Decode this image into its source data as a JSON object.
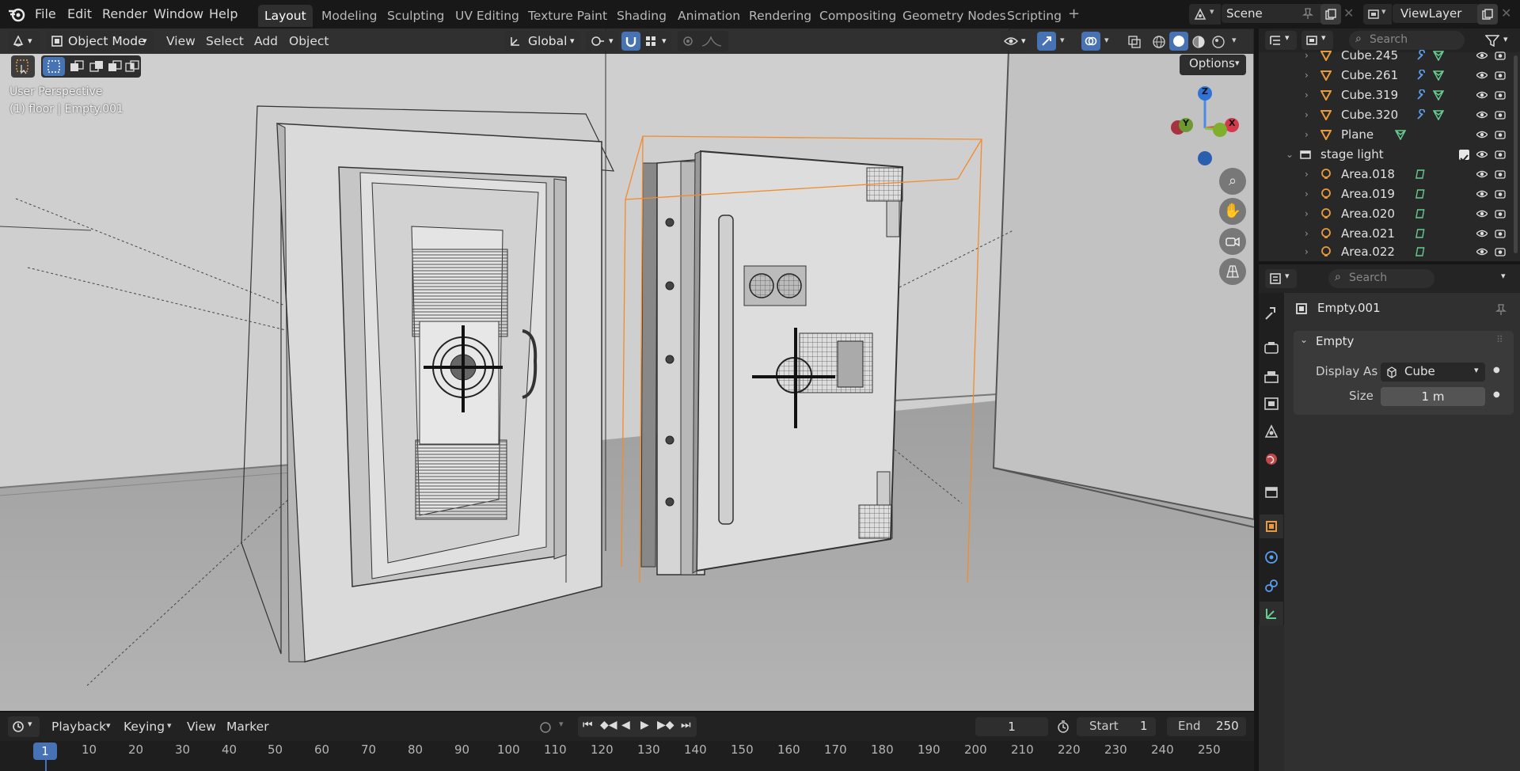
{
  "topbar": {
    "menus": [
      "File",
      "Edit",
      "Render",
      "Window",
      "Help"
    ],
    "workspaces": [
      "Layout",
      "Modeling",
      "Sculpting",
      "UV Editing",
      "Texture Paint",
      "Shading",
      "Animation",
      "Rendering",
      "Compositing",
      "Geometry Nodes",
      "Scripting"
    ],
    "active_workspace": "Layout",
    "add_workspace": "+",
    "scene": "Scene",
    "view_layer": "ViewLayer"
  },
  "viewport": {
    "mode": "Object Mode",
    "menus": [
      "View",
      "Select",
      "Add",
      "Object"
    ],
    "transform_orientation": "Global",
    "options_label": "Options",
    "overlay_text_1": "User Perspective",
    "overlay_text_2": "(1) floor | Empty.001",
    "gizmo": {
      "x": "X",
      "y": "Y",
      "z": "Z"
    }
  },
  "timeline": {
    "menus": [
      "Playback",
      "Keying",
      "View",
      "Marker"
    ],
    "current_frame": "1",
    "start_label": "Start",
    "start_value": "1",
    "end_label": "End",
    "end_value": "250",
    "ruler": [
      "1",
      "10",
      "20",
      "30",
      "40",
      "50",
      "60",
      "70",
      "80",
      "90",
      "100",
      "110",
      "120",
      "130",
      "140",
      "150",
      "160",
      "170",
      "180",
      "190",
      "200",
      "210",
      "220",
      "230",
      "240",
      "250"
    ]
  },
  "outliner": {
    "search_placeholder": "Search",
    "rows": [
      {
        "name": "Cube.245",
        "type": "mesh"
      },
      {
        "name": "Cube.261",
        "type": "mesh"
      },
      {
        "name": "Cube.319",
        "type": "mesh"
      },
      {
        "name": "Cube.320",
        "type": "mesh"
      },
      {
        "name": "Plane",
        "type": "mesh"
      },
      {
        "name": "stage light",
        "type": "collection"
      },
      {
        "name": "Area.018",
        "type": "light"
      },
      {
        "name": "Area.019",
        "type": "light"
      },
      {
        "name": "Area.020",
        "type": "light"
      },
      {
        "name": "Area.021",
        "type": "light"
      },
      {
        "name": "Area.022",
        "type": "light"
      }
    ]
  },
  "properties": {
    "search_placeholder": "Search",
    "object_name": "Empty.001",
    "panel_title": "Empty",
    "display_as_label": "Display As",
    "display_as_value": "Cube",
    "size_label": "Size",
    "size_value": "1 m"
  },
  "colors": {
    "accent_blue": "#4772b3",
    "selection_orange": "#f28b2c",
    "mesh_orange": "#e89a3c",
    "data_green": "#66cc8f",
    "modifier_blue": "#5c9ded"
  }
}
